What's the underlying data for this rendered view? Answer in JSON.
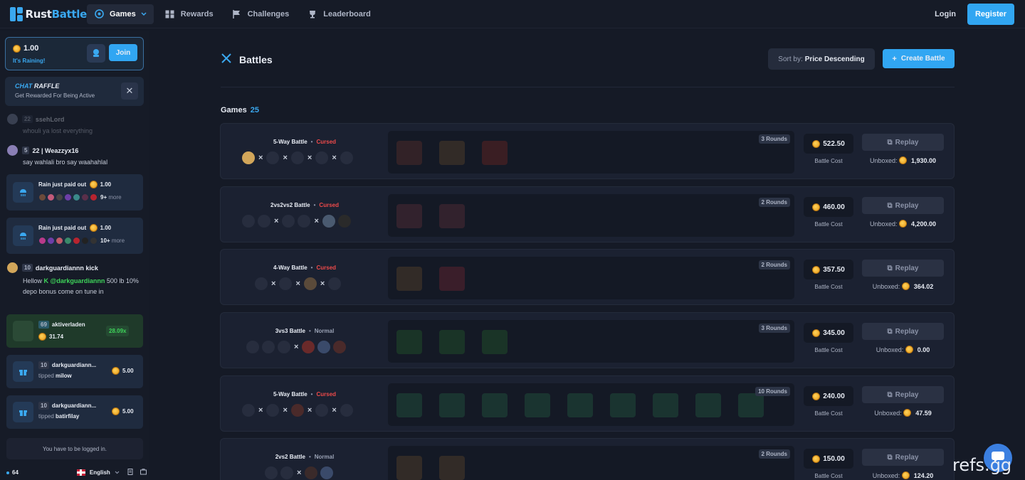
{
  "brand": {
    "part1": "Rust",
    "part2": "Battle"
  },
  "nav": {
    "games": "Games",
    "rewards": "Rewards",
    "challenges": "Challenges",
    "leaderboard": "Leaderboard",
    "login": "Login",
    "register": "Register"
  },
  "sidebar": {
    "rain": {
      "amount": "1.00",
      "label": "It's Raining!",
      "join": "Join"
    },
    "raffle": {
      "title_a": "CHAT",
      "title_b": "RAFFLE",
      "subtitle": "Get Rewarded For Being Active"
    },
    "messages": [
      {
        "level": "22",
        "user": "ssehLord",
        "text": "whouli ya lost everything"
      },
      {
        "level": "5",
        "user": "22 | Weazzyx16",
        "text": "say wahlali bro say waahahlal"
      }
    ],
    "rain_payouts": [
      {
        "title": "Rain just paid out",
        "amount": "1.00",
        "more_count": "9+",
        "more_label": "more"
      },
      {
        "title": "Rain just paid out",
        "amount": "1.00",
        "more_count": "10+",
        "more_label": "more"
      }
    ],
    "kick_message": {
      "level": "10",
      "user": "darkguardiannn kick",
      "prefix": "Hellow",
      "mention": "@darkguardiannn",
      "rest": "500 lb 10% depo bonus come on tune in"
    },
    "win": {
      "level": "69",
      "user": "aktiverladen",
      "value": "31.74",
      "multiplier": "28.09x"
    },
    "tips": [
      {
        "level": "10",
        "user": "darkguardiann...",
        "tipped_label": "tipped",
        "target": "milow",
        "amount": "5.00"
      },
      {
        "level": "10",
        "user": "darkguardiann...",
        "tipped_label": "tipped",
        "target": "batirfilay",
        "amount": "5.00"
      }
    ],
    "logged_notice": "You have to be logged in.",
    "online": "64",
    "language": "English"
  },
  "main": {
    "title": "Battles",
    "sort_label": "Sort by:",
    "sort_value": "Price Descending",
    "create_label": "Create Battle",
    "games_label": "Games",
    "games_count": "25"
  },
  "battles": [
    {
      "name": "5-Way Battle",
      "mode": "Cursed",
      "rounds": "3 Rounds",
      "price": "522.50",
      "cost_label": "Battle Cost",
      "replay": "Replay",
      "unboxed_label": "Unboxed:",
      "unboxed": "1,930.00"
    },
    {
      "name": "2vs2vs2 Battle",
      "mode": "Cursed",
      "rounds": "2 Rounds",
      "price": "460.00",
      "cost_label": "Battle Cost",
      "replay": "Replay",
      "unboxed_label": "Unboxed:",
      "unboxed": "4,200.00"
    },
    {
      "name": "4-Way Battle",
      "mode": "Cursed",
      "rounds": "2 Rounds",
      "price": "357.50",
      "cost_label": "Battle Cost",
      "replay": "Replay",
      "unboxed_label": "Unboxed:",
      "unboxed": "364.02"
    },
    {
      "name": "3vs3 Battle",
      "mode": "Normal",
      "rounds": "3 Rounds",
      "price": "345.00",
      "cost_label": "Battle Cost",
      "replay": "Replay",
      "unboxed_label": "Unboxed:",
      "unboxed": "0.00"
    },
    {
      "name": "5-Way Battle",
      "mode": "Cursed",
      "rounds": "10 Rounds",
      "price": "240.00",
      "cost_label": "Battle Cost",
      "replay": "Replay",
      "unboxed_label": "Unboxed:",
      "unboxed": "47.59"
    },
    {
      "name": "2vs2 Battle",
      "mode": "Normal",
      "rounds": "2 Rounds",
      "price": "150.00",
      "cost_label": "Battle Cost",
      "replay": "Replay",
      "unboxed_label": "Unboxed:",
      "unboxed": "124.20"
    }
  ],
  "watermark": "refs.gg",
  "colors": {
    "accent": "#31a6f2",
    "cursed": "#ee4a4a",
    "win": "#3ed45a",
    "background": "#151a26"
  }
}
